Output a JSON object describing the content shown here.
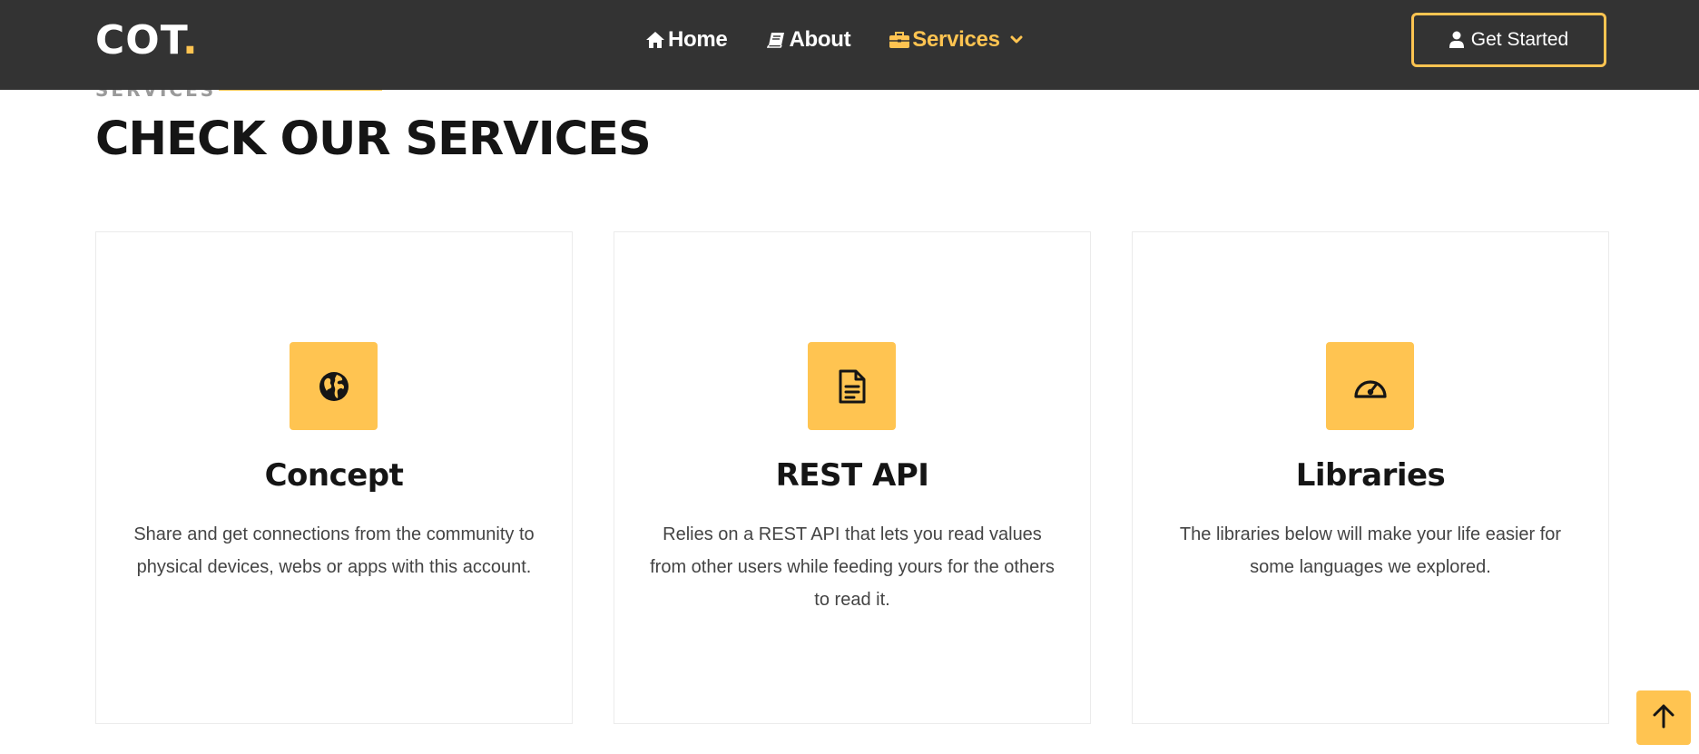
{
  "header": {
    "logo_text": "COT",
    "logo_dot": ".",
    "nav": [
      {
        "label": "Home",
        "icon": "home-icon"
      },
      {
        "label": "About",
        "icon": "book-icon"
      },
      {
        "label": "Services",
        "icon": "briefcase-icon",
        "active": true
      }
    ],
    "cta_label": "Get Started"
  },
  "section": {
    "label": "Services",
    "heading": "Check our Services"
  },
  "cards": [
    {
      "title": "Concept",
      "icon": "globe-icon",
      "text": "Share and get connections from the community to physical devices, webs or apps with this account."
    },
    {
      "title": "REST API",
      "icon": "document-icon",
      "text": "Relies on a REST API that lets you read values from other users while feeding yours for the others to read it."
    },
    {
      "title": "Libraries",
      "icon": "speedometer-icon",
      "text": "The libraries below will make your life easier for some languages we explored."
    }
  ],
  "colors": {
    "accent": "#ffc451",
    "header_bg": "#333333",
    "heading": "#151515",
    "body_text": "#444444"
  }
}
